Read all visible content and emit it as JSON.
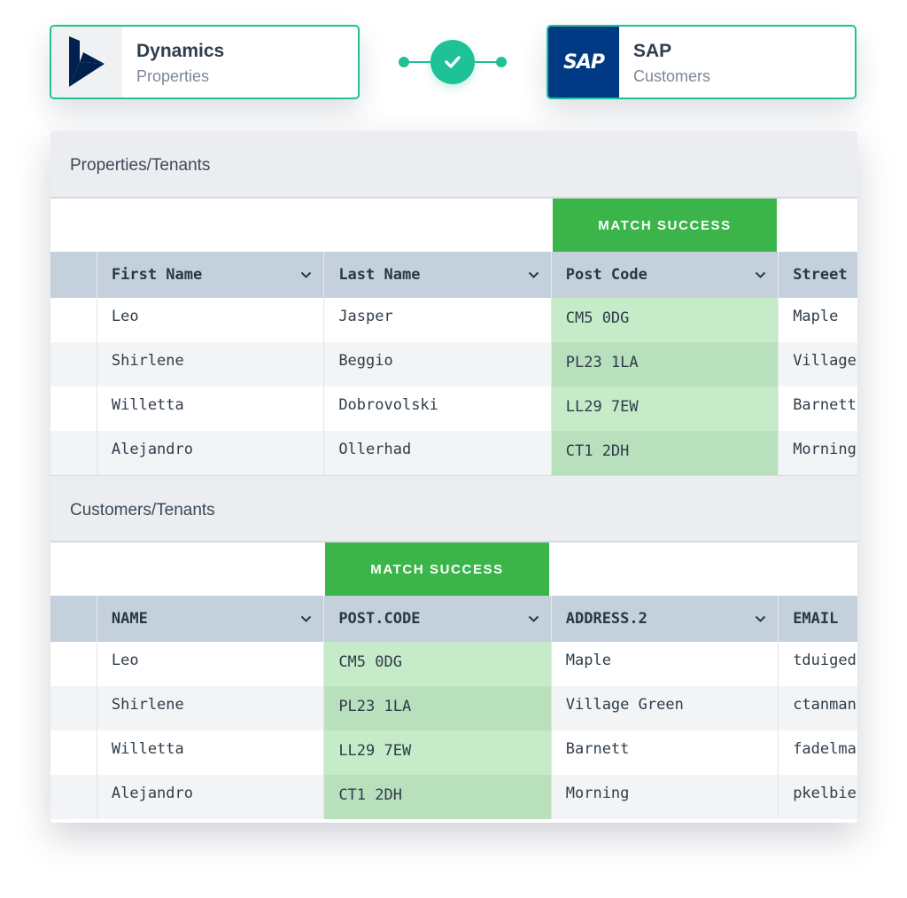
{
  "connectors": {
    "source": {
      "title": "Dynamics",
      "subtitle": "Properties",
      "logo": "dynamics-logo"
    },
    "target": {
      "title": "SAP",
      "subtitle": "Customers",
      "logo_text": "SAP"
    },
    "link_icon": "check-icon"
  },
  "colors": {
    "accent": "#1fc196",
    "match_badge": "#3bb54a",
    "match_cell": "#c6ebc9",
    "header_bg": "#c5d0dd",
    "sap_blue": "#003a84",
    "dynamics_navy": "#002050"
  },
  "tables": [
    {
      "title": "Properties/Tenants",
      "badge": "MATCH SUCCESS",
      "match_column": 2,
      "columns": [
        "First Name",
        "Last Name",
        "Post Code",
        "Street"
      ],
      "rows": [
        [
          "Leo",
          "Jasper",
          "CM5 0DG",
          "Maple"
        ],
        [
          "Shirlene",
          "Beggio",
          "PL23 1LA",
          "Village"
        ],
        [
          "Willetta",
          "Dobrovolski",
          "LL29 7EW",
          "Barnett"
        ],
        [
          "Alejandro",
          "Ollerhad",
          "CT1 2DH",
          "Morning"
        ]
      ]
    },
    {
      "title": "Customers/Tenants",
      "badge": "MATCH SUCCESS",
      "match_column": 1,
      "columns": [
        "NAME",
        "POST.CODE",
        "ADDRESS.2",
        "EMAIL"
      ],
      "rows": [
        [
          "Leo",
          "CM5 0DG",
          "Maple",
          "tduiged"
        ],
        [
          "Shirlene",
          "PL23 1LA",
          "Village Green",
          "ctanman"
        ],
        [
          "Willetta",
          "LL29 7EW",
          "Barnett",
          "fadelma"
        ],
        [
          "Alejandro",
          "CT1 2DH",
          "Morning",
          "pkelbie"
        ]
      ]
    }
  ]
}
